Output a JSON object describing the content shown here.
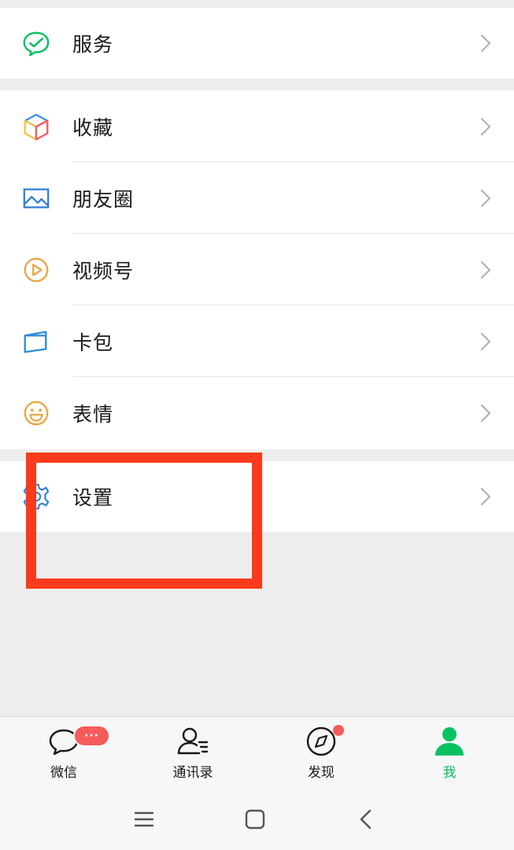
{
  "menu": {
    "service": {
      "label": "服务",
      "icon": "wechat-pay-icon"
    },
    "items": [
      {
        "label": "收藏",
        "icon": "favorites-cube-icon"
      },
      {
        "label": "朋友圈",
        "icon": "moments-image-icon"
      },
      {
        "label": "视频号",
        "icon": "channels-play-icon"
      },
      {
        "label": "卡包",
        "icon": "card-wallet-icon"
      },
      {
        "label": "表情",
        "icon": "sticker-smile-icon"
      }
    ],
    "settings": {
      "label": "设置",
      "icon": "gear-icon"
    }
  },
  "tabbar": {
    "tabs": [
      {
        "label": "微信",
        "icon": "chat-bubble-icon",
        "active": false
      },
      {
        "label": "通讯录",
        "icon": "contacts-icon",
        "active": false
      },
      {
        "label": "发现",
        "icon": "compass-icon",
        "active": false
      },
      {
        "label": "我",
        "icon": "person-icon",
        "active": true
      }
    ],
    "chat_badge": "···"
  },
  "colors": {
    "accent": "#07c160",
    "badge": "#f55b5b",
    "highlight": "#fa3a1c",
    "background": "#ededed"
  },
  "system_nav": {
    "icons": [
      "menu-icon",
      "home-icon",
      "back-icon"
    ]
  }
}
